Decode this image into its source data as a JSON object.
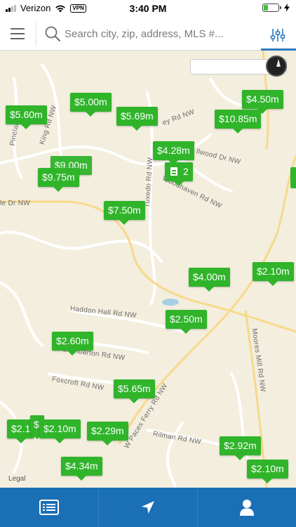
{
  "status_bar": {
    "carrier": "Verizon",
    "vpn": "VPN",
    "time": "3:40 PM",
    "battery_level": 0.3
  },
  "search": {
    "placeholder": "Search city, zip, address, MLS #..."
  },
  "map": {
    "legal": "Legal",
    "road_labels": [
      "Pineland Rd",
      "King Rd NW",
      "le Dr NW",
      "Tuxedo Rd NW",
      "llwood Dr NW",
      "Woodhaven Rd NW",
      "Haddon Hall Rd NW",
      "Dumbarton Rd NW",
      "Foxcroft Rd NW",
      "Rilman Rd NW",
      "Moores Mill Rd NW",
      "W Paces Ferry Rd NW",
      "ey Rd NW"
    ],
    "pins": [
      "$5.60m",
      "$5.00m",
      "$5.69m",
      "$4.50m",
      "$10.85m",
      "$4.28m",
      "$9.75m",
      "$7.50m",
      "$4.00m",
      "$2.10m",
      "$2.50m",
      "$2.60m",
      "$5.65m",
      "$2.1",
      "$2.10m",
      "$2.29m",
      "$2.92m",
      "$4.34m",
      "$2.10m"
    ],
    "hidden_pin": "$9.00m",
    "building": {
      "count": "2"
    }
  },
  "tabs": [
    "list",
    "nearby",
    "account"
  ],
  "colors": {
    "pin": "#2fb42a",
    "tab_bar": "#1a6fb5",
    "accent": "#2d7cbf",
    "map_bg": "#f3eede"
  }
}
